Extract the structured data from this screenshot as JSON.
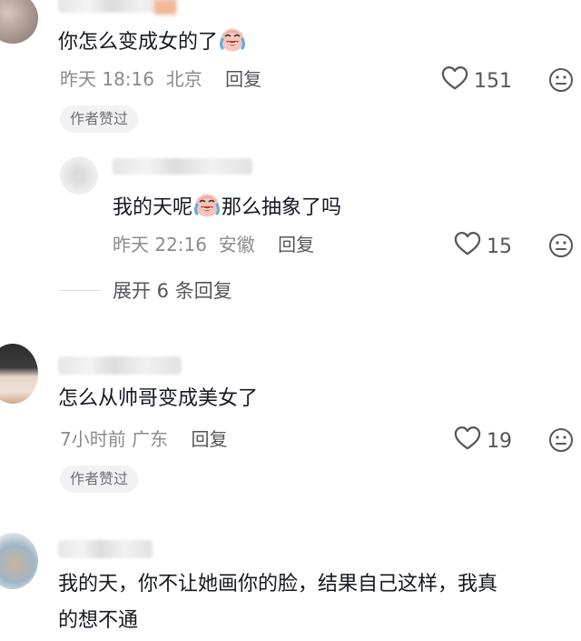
{
  "comments": [
    {
      "text_before": "你怎么变成女的了",
      "emoji": "crying-laughing-emoji",
      "time": "昨天 18:16",
      "location": "北京",
      "reply_label": "回复",
      "likes": "151",
      "badge": "作者赞过"
    },
    {
      "text": "怎么从帅哥变成美女了",
      "time": "7小时前",
      "location": "广东",
      "reply_label": "回复",
      "likes": "19",
      "badge": "作者赞过"
    },
    {
      "text_line1": "我的天，你不让她画你的脸，结果自己这样，我真",
      "text_line2": "的想不通"
    }
  ],
  "reply": {
    "text_before": "我的天呢",
    "emoji": "crying-laughing-emoji",
    "text_after": "那么抽象了吗",
    "time": "昨天 22:16",
    "location": "安徽",
    "reply_label": "回复",
    "likes": "15"
  },
  "expand_label": "展开 6 条回复",
  "colors": {
    "text_primary": "#161823",
    "text_secondary": "#8a8b91",
    "badge_bg": "#f2f2f4"
  }
}
